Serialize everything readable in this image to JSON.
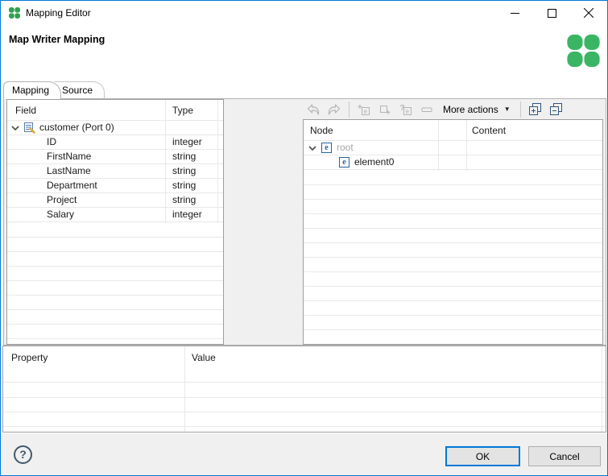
{
  "window": {
    "title": "Mapping Editor"
  },
  "header": {
    "title": "Map Writer Mapping"
  },
  "tabs": [
    {
      "label": "Mapping",
      "active": true
    },
    {
      "label": "Source",
      "active": false
    }
  ],
  "field_table": {
    "columns": [
      "Field",
      "Type"
    ],
    "root_label": "customer (Port 0)",
    "rows": [
      {
        "field": "ID",
        "type": "integer"
      },
      {
        "field": "FirstName",
        "type": "string"
      },
      {
        "field": "LastName",
        "type": "string"
      },
      {
        "field": "Department",
        "type": "string"
      },
      {
        "field": "Project",
        "type": "string"
      },
      {
        "field": "Salary",
        "type": "integer"
      }
    ]
  },
  "toolbar": {
    "more_actions_label": "More actions",
    "dropdown_glyph": "▼"
  },
  "node_table": {
    "columns": [
      "Node",
      "Content"
    ],
    "tree": [
      {
        "label": "root"
      },
      {
        "label": "element0"
      }
    ]
  },
  "property_table": {
    "columns": [
      "Property",
      "Value"
    ]
  },
  "footer": {
    "help_label": "?",
    "ok_label": "OK",
    "cancel_label": "Cancel"
  },
  "icons": {
    "element_letter": "e",
    "plus_glyph": "+",
    "question_glyph": "?"
  },
  "colors": {
    "accent": "#0079d8",
    "clover_green": "#3ab564",
    "muted_text": "#a6a6a6",
    "disabled_icon": "#b5b5b5"
  }
}
